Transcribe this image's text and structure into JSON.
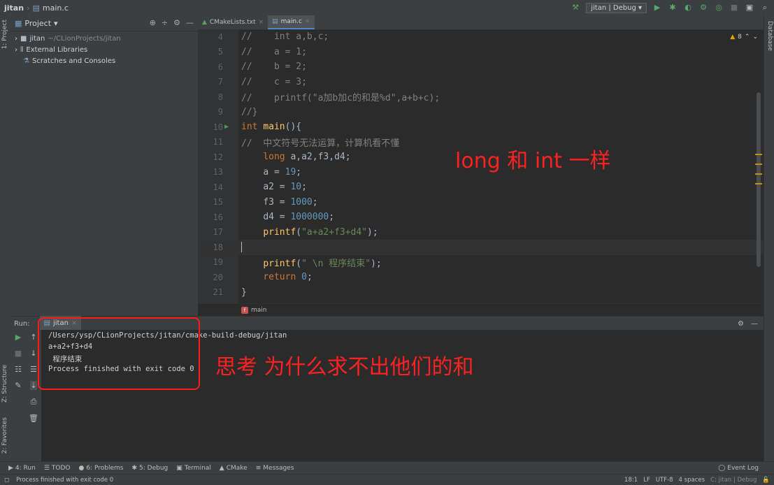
{
  "breadcrumb": {
    "project": "jitan",
    "file": "main.c"
  },
  "toolbar": {
    "config": "jitan | Debug"
  },
  "left_strip": {
    "project": "1: Project",
    "structure": "Z: Structure",
    "favorites": "2: Favorites"
  },
  "right_strip": {
    "database": "Database"
  },
  "project_panel": {
    "title": "Project",
    "items": [
      {
        "name": "jitan",
        "path": "~/CLionProjects/jitan"
      },
      {
        "name": "External Libraries"
      },
      {
        "name": "Scratches and Consoles"
      }
    ]
  },
  "editor": {
    "tabs": [
      {
        "label": "CMakeLists.txt",
        "active": false
      },
      {
        "label": "main.c",
        "active": true
      }
    ],
    "warnings": "8",
    "lines": [
      {
        "num": "4",
        "text": "//    int a,b,c;"
      },
      {
        "num": "5",
        "text": "//    a = 1;"
      },
      {
        "num": "6",
        "text": "//    b = 2;"
      },
      {
        "num": "7",
        "text": "//    c = 3;"
      },
      {
        "num": "8",
        "text": "//    printf(\"a加b加c的和是%d\",a+b+c);"
      },
      {
        "num": "9",
        "text": "//}"
      },
      {
        "num": "10",
        "text": "int main(){"
      },
      {
        "num": "11",
        "text": "//  中文符号无法运算，计算机看不懂"
      },
      {
        "num": "12",
        "text": "    long a,a2,f3,d4;"
      },
      {
        "num": "13",
        "text": "    a = 19;"
      },
      {
        "num": "14",
        "text": "    a2 = 10;"
      },
      {
        "num": "15",
        "text": "    f3 = 1000;"
      },
      {
        "num": "16",
        "text": "    d4 = 1000000;"
      },
      {
        "num": "17",
        "text": "    printf(\"a+a2+f3+d4\");"
      },
      {
        "num": "18",
        "text": ""
      },
      {
        "num": "19",
        "text": "    printf(\" \\n 程序结束\");"
      },
      {
        "num": "20",
        "text": "    return 0;"
      },
      {
        "num": "21",
        "text": "}"
      }
    ],
    "function_crumb": "main"
  },
  "run_panel": {
    "label": "Run:",
    "tab": "jitan",
    "output": [
      "/Users/ysp/CLionProjects/jitan/cmake-build-debug/jitan",
      "a+a2+f3+d4",
      " 程序结束",
      "Process finished with exit code 0"
    ]
  },
  "annotations": {
    "editor_note": "long 和 int 一样",
    "console_note": "思考 为什么求不出他们的和",
    "color": "#ff2020"
  },
  "bottom_tabs": [
    "4: Run",
    "TODO",
    "6: Problems",
    "5: Debug",
    "Terminal",
    "CMake",
    "Messages"
  ],
  "event_log": "Event Log",
  "status": {
    "message": "Process finished with exit code 0",
    "position": "18:1",
    "line_sep": "LF",
    "encoding": "UTF-8",
    "indent": "4 spaces",
    "context": "C: jitan | Debug"
  }
}
